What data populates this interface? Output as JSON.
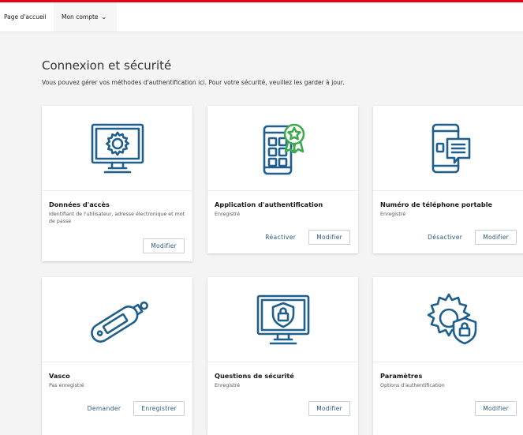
{
  "nav": {
    "home": "Page d'accueil",
    "account": "Mon compte",
    "account_chevron": "⌄"
  },
  "header": {
    "title": "Connexion et sécurité",
    "subtitle": "Vous pouvez gérer vos méthodes d'authentification ici. Pour votre sécurité, veuillez les garder à jour."
  },
  "colors": {
    "accent_red": "#e2001a",
    "icon_blue": "#1f5f8b",
    "badge_green": "#3fa94f",
    "link_blue": "#2a5a82"
  },
  "cards": [
    {
      "icon": "monitor-gear-icon",
      "title": "Données d'accès",
      "desc": "Identifiant de l'utilisateur, adresse électronique et mot de passe",
      "link": "",
      "button": "Modifier"
    },
    {
      "icon": "phone-app-badge-icon",
      "title": "Application d'authentification",
      "desc": "Enregistré",
      "link": "Réactiver",
      "button": "Modifier"
    },
    {
      "icon": "phone-message-icon",
      "title": "Numéro de téléphone portable",
      "desc": "Enregistré",
      "link": "Désactiver",
      "button": "Modifier"
    },
    {
      "icon": "token-device-icon",
      "title": "Vasco",
      "desc": "Pas enregistré",
      "link": "Demander",
      "button": "Enregistrer"
    },
    {
      "icon": "monitor-shield-icon",
      "title": "Questions de sécurité",
      "desc": "Enregistré",
      "link": "",
      "button": "Modifier"
    },
    {
      "icon": "gear-shield-icon",
      "title": "Paramètres",
      "desc": "Options d'authentification",
      "link": "",
      "button": "Modifier"
    }
  ]
}
